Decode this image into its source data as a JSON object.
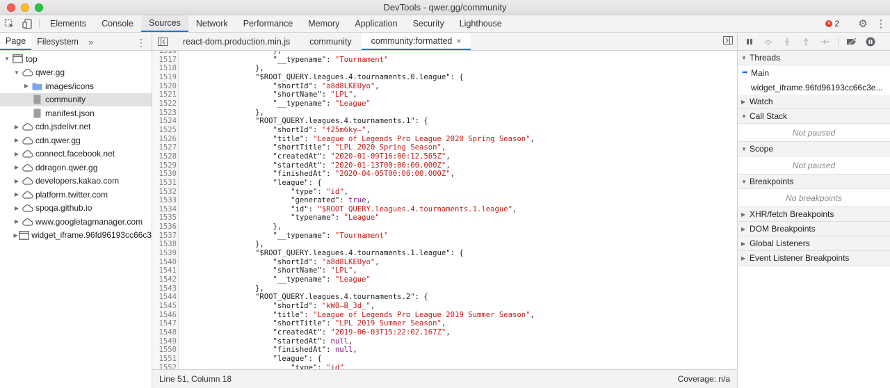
{
  "window": {
    "title": "DevTools - qwer.gg/community"
  },
  "main_tabs": [
    "Elements",
    "Console",
    "Sources",
    "Network",
    "Performance",
    "Memory",
    "Application",
    "Security",
    "Lighthouse"
  ],
  "active_main_tab": "Sources",
  "error_count": "2",
  "navigator": {
    "tabs": [
      "Page",
      "Filesystem"
    ],
    "more": "»",
    "tree": [
      {
        "label": "top",
        "depth": 0,
        "icon": "frame",
        "expanded": true
      },
      {
        "label": "qwer.gg",
        "depth": 1,
        "icon": "cloud",
        "expanded": true
      },
      {
        "label": "images/icons",
        "depth": 2,
        "icon": "folder",
        "expanded": false
      },
      {
        "label": "community",
        "depth": 2,
        "icon": "file",
        "selected": true
      },
      {
        "label": "manifest.json",
        "depth": 2,
        "icon": "file"
      },
      {
        "label": "cdn.jsdelivr.net",
        "depth": 1,
        "icon": "cloud",
        "expanded": false
      },
      {
        "label": "cdn.qwer.gg",
        "depth": 1,
        "icon": "cloud",
        "expanded": false
      },
      {
        "label": "connect.facebook.net",
        "depth": 1,
        "icon": "cloud",
        "expanded": false
      },
      {
        "label": "ddragon.qwer.gg",
        "depth": 1,
        "icon": "cloud",
        "expanded": false
      },
      {
        "label": "developers.kakao.com",
        "depth": 1,
        "icon": "cloud",
        "expanded": false
      },
      {
        "label": "platform.twitter.com",
        "depth": 1,
        "icon": "cloud",
        "expanded": false
      },
      {
        "label": "spoqa.github.io",
        "depth": 1,
        "icon": "cloud",
        "expanded": false
      },
      {
        "label": "www.googletagmanager.com",
        "depth": 1,
        "icon": "cloud",
        "expanded": false
      },
      {
        "label": "widget_iframe.96fd96193cc66c3",
        "depth": 1,
        "icon": "frame",
        "expanded": false
      }
    ]
  },
  "editor": {
    "tabs": [
      {
        "label": "react-dom.production.min.js",
        "active": false
      },
      {
        "label": "community",
        "active": false
      },
      {
        "label": "community:formatted",
        "active": true,
        "closable": true
      }
    ],
    "close_glyph": "×",
    "lines": [
      {
        "n": "1516",
        "text": "                    },\n"
      },
      {
        "n": "1517",
        "text": "                    \"__typename\": \"Tournament\""
      },
      {
        "n": "1518",
        "text": "                },"
      },
      {
        "n": "1519",
        "text": "                \"$ROOT_QUERY.leagues.4.tournaments.0.league\": {"
      },
      {
        "n": "1520",
        "text": "                    \"shortId\": \"a8d8LKEUyo\","
      },
      {
        "n": "1521",
        "text": "                    \"shortName\": \"LPL\","
      },
      {
        "n": "1522",
        "text": "                    \"__typename\": \"League\""
      },
      {
        "n": "1523",
        "text": "                },"
      },
      {
        "n": "1524",
        "text": "                \"ROOT_QUERY.leagues.4.tournaments.1\": {"
      },
      {
        "n": "1525",
        "text": "                    \"shortId\": \"f25m6ky—\","
      },
      {
        "n": "1526",
        "text": "                    \"title\": \"League of Legends Pro League 2020 Spring Season\","
      },
      {
        "n": "1527",
        "text": "                    \"shortTitle\": \"LPL 2020 Spring Season\","
      },
      {
        "n": "1528",
        "text": "                    \"createdAt\": \"2020-01-09T16:00:12.565Z\","
      },
      {
        "n": "1529",
        "text": "                    \"startedAt\": \"2020-01-13T00:00:00.000Z\","
      },
      {
        "n": "1530",
        "text": "                    \"finishedAt\": \"2020-04-05T00:00:00.000Z\","
      },
      {
        "n": "1531",
        "text": "                    \"league\": {"
      },
      {
        "n": "1532",
        "text": "                        \"type\": \"id\","
      },
      {
        "n": "1533",
        "text": "                        \"generated\": true,"
      },
      {
        "n": "1534",
        "text": "                        \"id\": \"$ROOT_QUERY.leagues.4.tournaments.1.league\","
      },
      {
        "n": "1535",
        "text": "                        \"typename\": \"League\""
      },
      {
        "n": "1536",
        "text": "                    },"
      },
      {
        "n": "1537",
        "text": "                    \"__typename\": \"Tournament\""
      },
      {
        "n": "1538",
        "text": "                },"
      },
      {
        "n": "1539",
        "text": "                \"$ROOT_QUERY.leagues.4.tournaments.1.league\": {"
      },
      {
        "n": "1540",
        "text": "                    \"shortId\": \"a8d8LKEUyo\","
      },
      {
        "n": "1541",
        "text": "                    \"shortName\": \"LPL\","
      },
      {
        "n": "1542",
        "text": "                    \"__typename\": \"League\""
      },
      {
        "n": "1543",
        "text": "                },"
      },
      {
        "n": "1544",
        "text": "                \"ROOT_QUERY.leagues.4.tournaments.2\": {"
      },
      {
        "n": "1545",
        "text": "                    \"shortId\": \"kW0—B_3d_\","
      },
      {
        "n": "1546",
        "text": "                    \"title\": \"League of Legends Pro League 2019 Summer Season\","
      },
      {
        "n": "1547",
        "text": "                    \"shortTitle\": \"LPL 2019 Summer Season\","
      },
      {
        "n": "1548",
        "text": "                    \"createdAt\": \"2019-06-03T15:22:02.167Z\","
      },
      {
        "n": "1549",
        "text": "                    \"startedAt\": null,"
      },
      {
        "n": "1550",
        "text": "                    \"finishedAt\": null,"
      },
      {
        "n": "1551",
        "text": "                    \"league\": {"
      },
      {
        "n": "1552",
        "text": "                        \"type\": \"id\""
      }
    ]
  },
  "status": {
    "position": "Line 51, Column 18",
    "coverage": "Coverage: n/a"
  },
  "debugger": {
    "sections": [
      {
        "title": "Threads",
        "expanded": true,
        "rows": [
          {
            "label": "Main",
            "current": true
          },
          {
            "label": "widget_iframe.96fd96193cc66c3e...",
            "current": false
          }
        ]
      },
      {
        "title": "Watch",
        "expanded": false
      },
      {
        "title": "Call Stack",
        "expanded": true,
        "note": "Not paused"
      },
      {
        "title": "Scope",
        "expanded": true,
        "note": "Not paused"
      },
      {
        "title": "Breakpoints",
        "expanded": true,
        "note": "No breakpoints"
      },
      {
        "title": "XHR/fetch Breakpoints",
        "expanded": false
      },
      {
        "title": "DOM Breakpoints",
        "expanded": false
      },
      {
        "title": "Global Listeners",
        "expanded": false
      },
      {
        "title": "Event Listener Breakpoints",
        "expanded": false
      }
    ]
  },
  "colors": {
    "accent": "#1a73e8",
    "string": "#c41a16",
    "keyword": "#881280",
    "folder": "#7aa7e9"
  }
}
